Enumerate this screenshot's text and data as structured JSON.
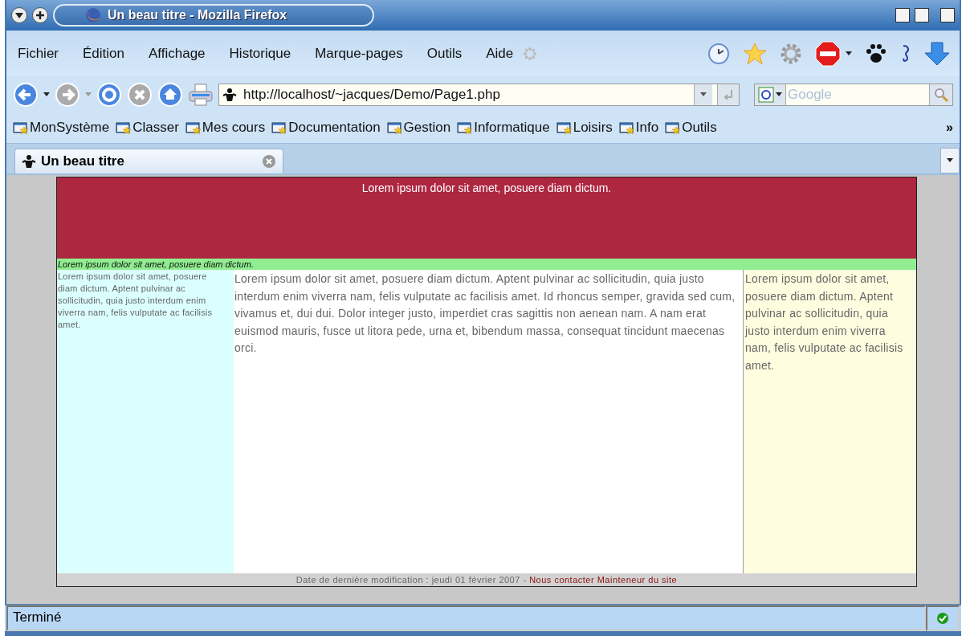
{
  "window": {
    "title": "Un beau titre - Mozilla Firefox"
  },
  "menu": [
    "Fichier",
    "Édition",
    "Affichage",
    "Historique",
    "Marque-pages",
    "Outils",
    "Aide"
  ],
  "address": {
    "value": "http://localhost/~jacques/Demo/Page1.php"
  },
  "search": {
    "placeholder": "Google"
  },
  "bookmarks": [
    "MonSystème",
    "Classer",
    "Mes cours",
    "Documentation",
    "Gestion",
    "Informatique",
    "Loisirs",
    "Info",
    "Outils"
  ],
  "bookmarks_more": "»",
  "tabs": [
    {
      "label": "Un beau titre",
      "selected": true
    }
  ],
  "page": {
    "header": "Lorem ipsum dolor sit amet, posuere diam dictum.",
    "subheader": "Lorem ipsum dolor sit amet, posuere diam dictum.",
    "left": "Lorem ipsum dolor sit amet, posuere diam dictum. Aptent pulvinar ac sollicitudin, quia justo interdum enim viverra nam, felis vulputate ac facilisis amet.",
    "main": "Lorem ipsum dolor sit amet, posuere diam dictum. Aptent pulvinar ac sollicitudin, quia justo interdum enim viverra nam, felis vulputate ac facilisis amet. Id rhoncus semper, gravida sed cum, vivamus et, dui dui. Dolor integer justo, imperdiet cras sagittis non aenean nam. A nam erat euismod mauris, fusce ut litora pede, urna et, bibendum massa, consequat tincidunt maecenas orci.",
    "right": "Lorem ipsum dolor sit amet, posuere diam dictum. Aptent pulvinar ac sollicitudin, quia justo interdum enim viverra nam, felis vulputate ac facilisis amet.",
    "footer": {
      "text": "Date de dernière modification : jeudi 01 février 2007 -",
      "links": [
        "Nous contacter",
        "Mainteneur du site"
      ]
    }
  },
  "status_bar": {
    "text": "Terminé"
  }
}
